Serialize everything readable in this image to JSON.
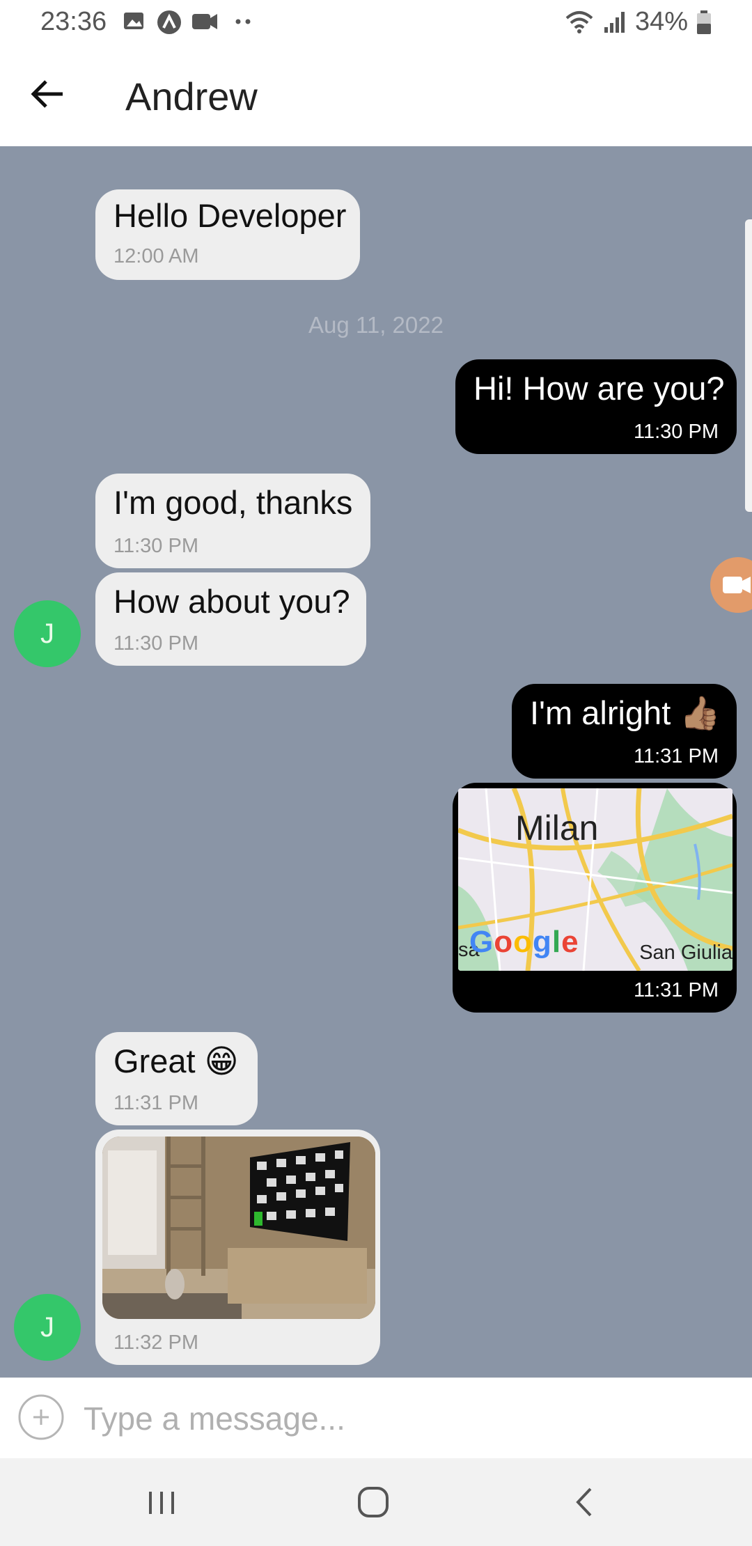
{
  "status_bar": {
    "time": "23:36",
    "battery": "34%"
  },
  "header": {
    "title": "Andrew"
  },
  "chat": {
    "date_separator": "Aug 11, 2022",
    "avatar_initial": "J",
    "messages": [
      {
        "text": "Hello Developer",
        "time": "12:00 AM"
      },
      {
        "text": "Hi! How are you?",
        "time": "11:30 PM"
      },
      {
        "text": "I'm good, thanks",
        "time": "11:30 PM"
      },
      {
        "text": "How about you?",
        "time": "11:30 PM"
      },
      {
        "text": "I'm alright 👍🏽",
        "time": "11:31 PM"
      },
      {
        "map_city": "Milan",
        "map_logo": "Google",
        "map_sublabel": "San Giulia",
        "map_edge": "sa",
        "time": "11:31 PM"
      },
      {
        "text": "Great 😁",
        "time": "11:31 PM"
      },
      {
        "time": "11:32 PM"
      }
    ]
  },
  "composer": {
    "placeholder": "Type a message..."
  }
}
